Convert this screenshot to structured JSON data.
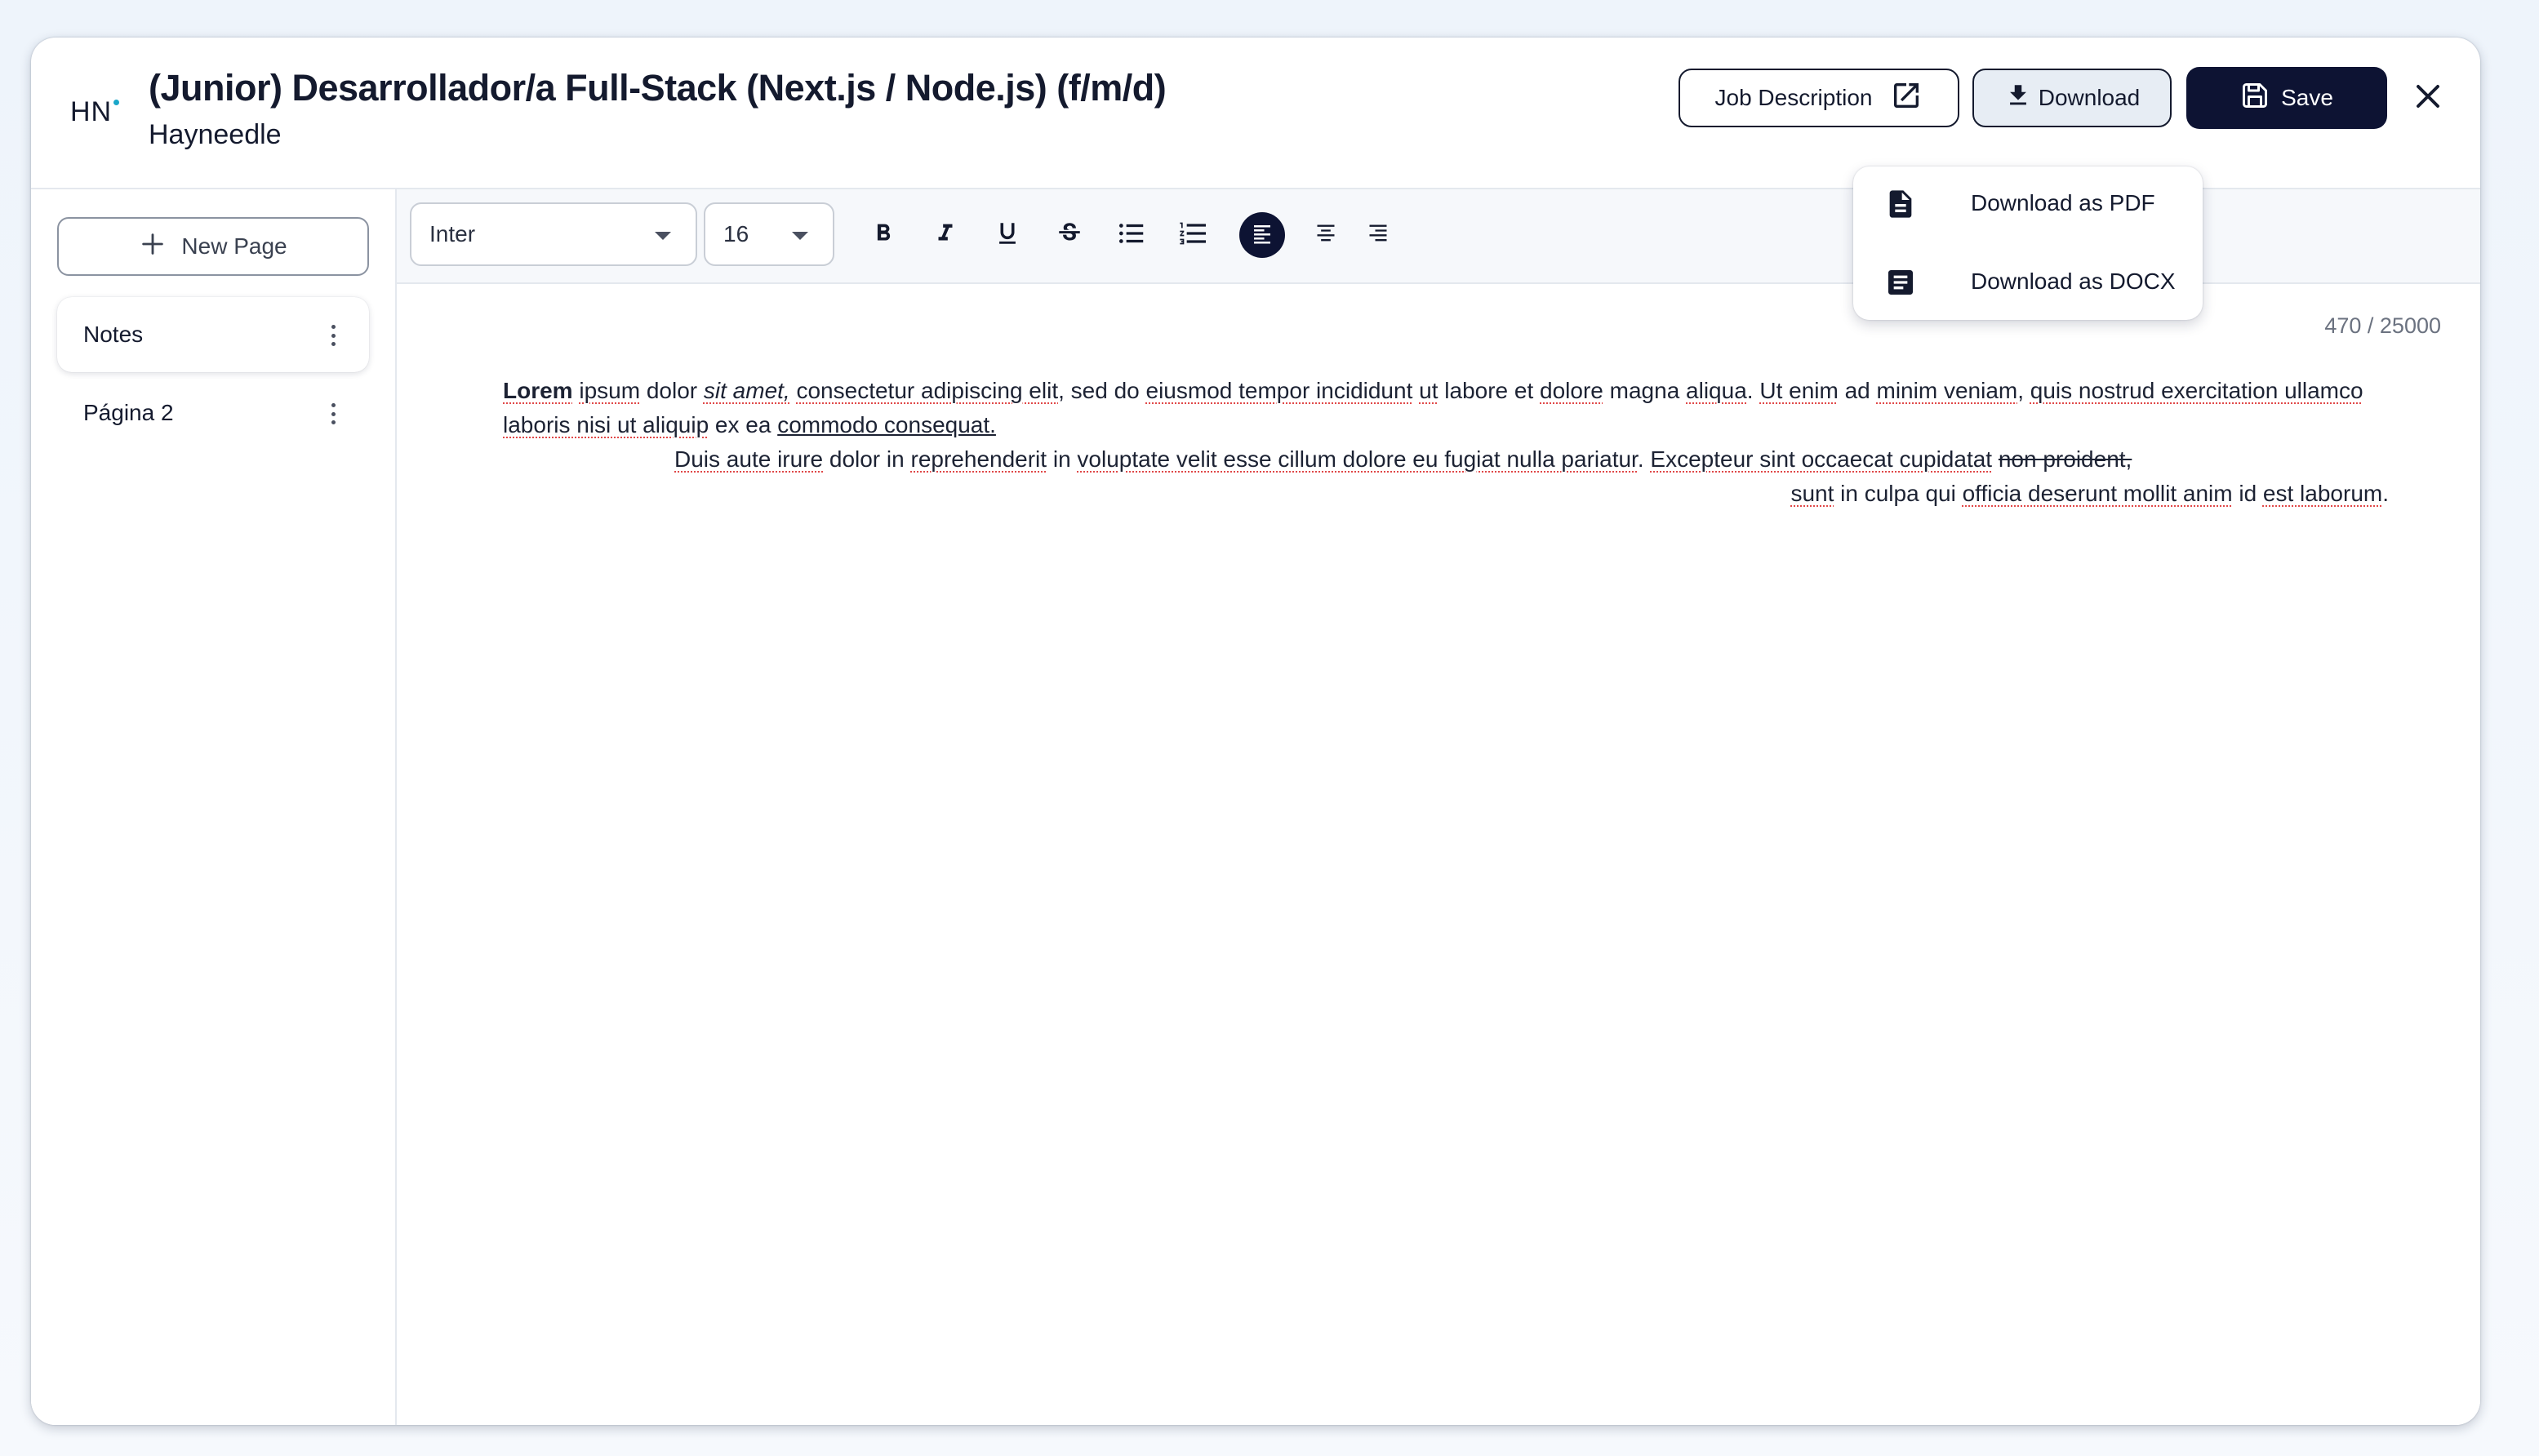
{
  "header": {
    "logo": "HN",
    "title": "(Junior) Desarrollador/a Full-Stack (Next.js / Node.js) (f/m/d)",
    "company": "Hayneedle",
    "job_description_label": "Job Description",
    "download_label": "Download",
    "save_label": "Save"
  },
  "download_menu": {
    "items": [
      {
        "label": "Download as PDF",
        "icon": "file-document-icon"
      },
      {
        "label": "Download as DOCX",
        "icon": "document-text-icon"
      }
    ]
  },
  "sidebar": {
    "new_page_label": "New Page",
    "pages": [
      {
        "label": "Notes",
        "active": true
      },
      {
        "label": "Página 2",
        "active": false
      }
    ]
  },
  "toolbar": {
    "font_family": "Inter",
    "font_size": "16",
    "buttons": [
      "bold-icon",
      "italic-icon",
      "underline-icon",
      "strikethrough-icon",
      "bullet-list-icon",
      "numbered-list-icon",
      "align-left-icon",
      "align-center-icon",
      "align-right-icon"
    ],
    "active_alignment": "left"
  },
  "editor": {
    "char_count": "470 / 25000",
    "p1": {
      "bold": "Lorem",
      "t1": "ipsum",
      "t2": " dolor ",
      "italic": "sit amet,",
      "t3": " ",
      "t4": "consectetur adipiscing elit",
      "t5": ", sed do ",
      "t6": "eiusmod tempor incididunt",
      "t7": " ",
      "t8": "ut",
      "t9": " labore et ",
      "t10": "dolore",
      "t11": " magna ",
      "t12": "aliqua",
      "t13": ". ",
      "t14": "Ut enim",
      "t15": " ad ",
      "t16": "minim veniam",
      "t17": ", ",
      "t18": "quis nostrud exercitation ullamco laboris nisi ut aliquip",
      "t19": " ex ea ",
      "underlined": "commodo consequat."
    },
    "p2": {
      "t1": "Duis aute irure",
      "t2": " dolor in ",
      "t3": "reprehenderit",
      "t4": " in ",
      "t5": "voluptate velit esse cillum dolore eu fugiat nulla pariatur",
      "t6": ". ",
      "t7": "Excepteur sint occaecat cupidatat",
      "t8": " ",
      "strike": "non proident,"
    },
    "p3": {
      "t1": "sunt",
      "t2": " in culpa qui ",
      "t3": "officia deserunt mollit anim",
      "t4": " id ",
      "t5": "est laborum",
      "t6": "."
    }
  },
  "colors": {
    "primary": "#0d1333",
    "spellcheck": "#e04848",
    "logo_dot": "#1aa7c9"
  }
}
